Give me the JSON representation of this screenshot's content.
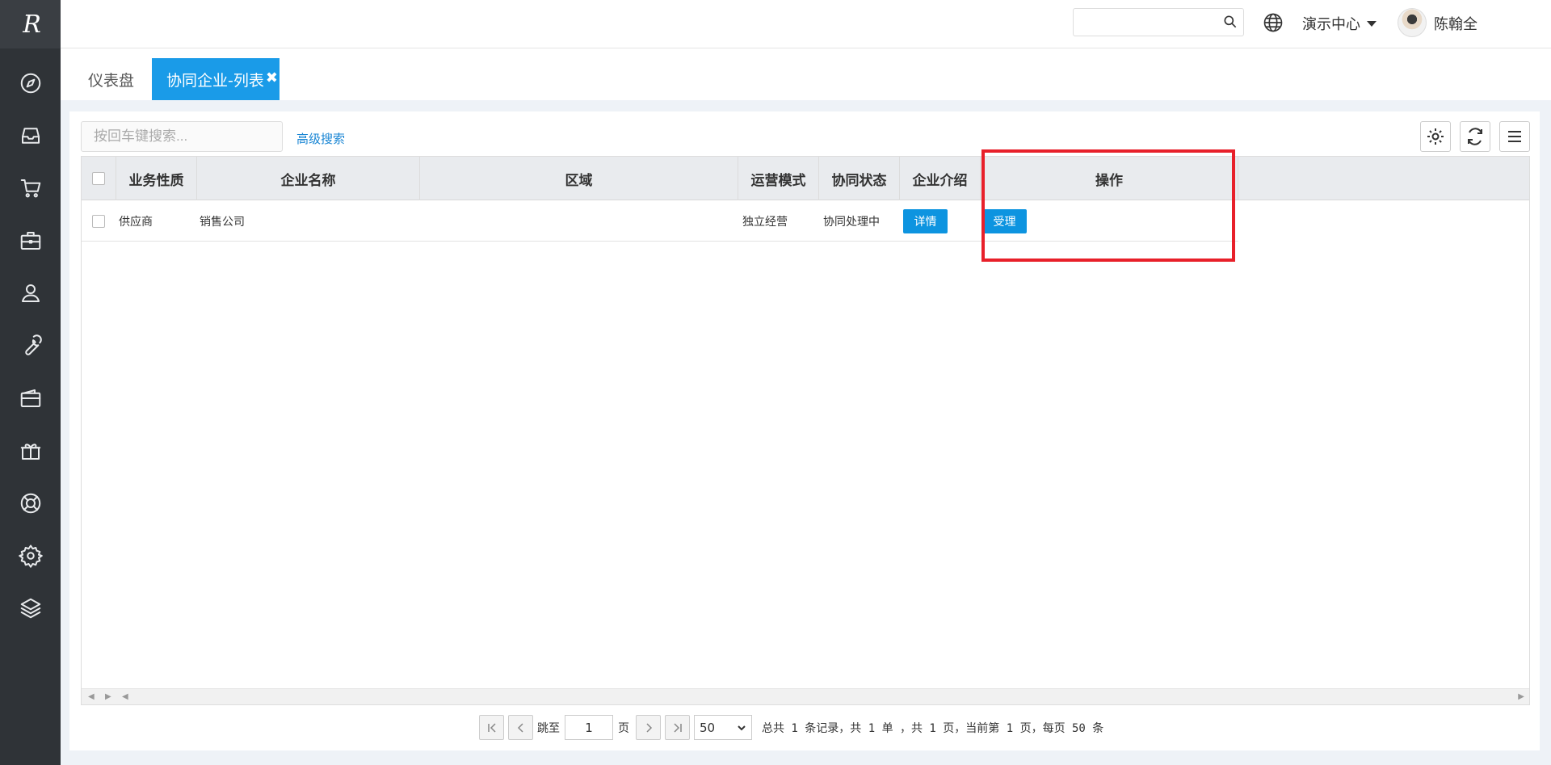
{
  "sidebar": {
    "logo_text": "R",
    "icons": [
      "compass-icon",
      "inbox-icon",
      "cart-icon",
      "briefcase-icon",
      "user-icon",
      "wrench-icon",
      "wallet-icon",
      "gift-icon",
      "lifebuoy-icon",
      "gear-icon",
      "layers-icon"
    ]
  },
  "topbar": {
    "search_placeholder": "",
    "center_label": "演示中心",
    "user_name": "陈翰全"
  },
  "tabs": [
    {
      "label": "仪表盘"
    },
    {
      "label": "协同企业-列表",
      "close": "✖"
    }
  ],
  "toolbar": {
    "search_placeholder": "按回车键搜索...",
    "advanced_search": "高级搜索"
  },
  "table": {
    "headers": [
      "业务性质",
      "企业名称",
      "区域",
      "运营模式",
      "协同状态",
      "企业介绍",
      "操作"
    ],
    "rows": [
      {
        "type": "供应商",
        "company": "销售公司",
        "region": "",
        "mode": "独立经营",
        "status": "协同处理中",
        "intro_button": "详情",
        "action_button": "受理"
      }
    ]
  },
  "pagination": {
    "jump_to": "跳至",
    "page_value": "1",
    "page_unit": "页",
    "page_size": "50",
    "info": "总共 1 条记录，共 1 单 ，共 1 页，当前第 1 页，每页 50 条"
  },
  "colors": {
    "accent": "#1a9be8",
    "sidebar": "#2f3337",
    "highlight": "#e8202a"
  }
}
